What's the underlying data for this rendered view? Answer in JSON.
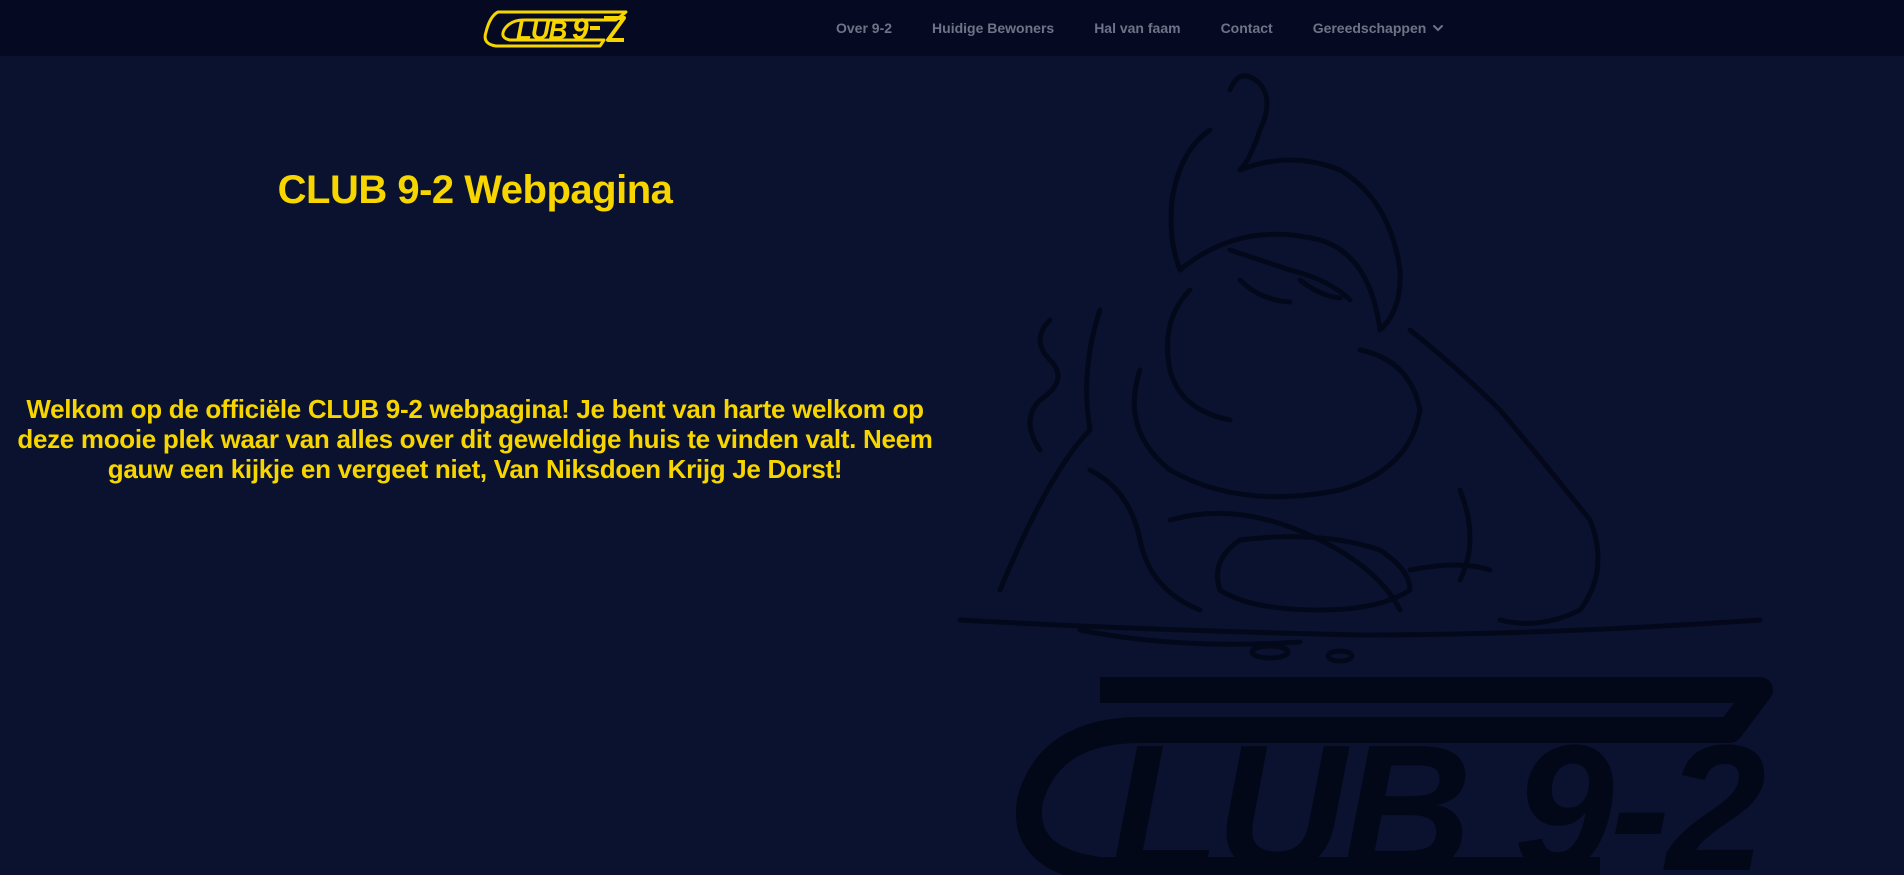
{
  "brand": {
    "logo_text": "CLUB 9-2",
    "accent_color": "#f7d600"
  },
  "nav": {
    "items": [
      {
        "label": "Over 9-2"
      },
      {
        "label": "Huidige Bewoners"
      },
      {
        "label": "Hal van faam"
      },
      {
        "label": "Contact"
      },
      {
        "label": "Gereedschappen",
        "icon": "chevron-down-icon"
      }
    ]
  },
  "hero": {
    "title": "CLUB 9-2 Webpagina",
    "body": "Welkom op de officiële CLUB 9-2 webpagina! Je bent van harte welkom op deze mooie plek waar van alles over dit geweldige huis te vinden valt. Neem gauw een kijkje en vergeet niet, Van Niksdoen Krijg Je Dorst!",
    "background_art": "cartoon-mascot-and-club-9-2-logo-illustration"
  },
  "colors": {
    "background": "#0a1230",
    "navbar": "#050a22",
    "nav_text": "#6e7487",
    "art_line": "#030818"
  }
}
